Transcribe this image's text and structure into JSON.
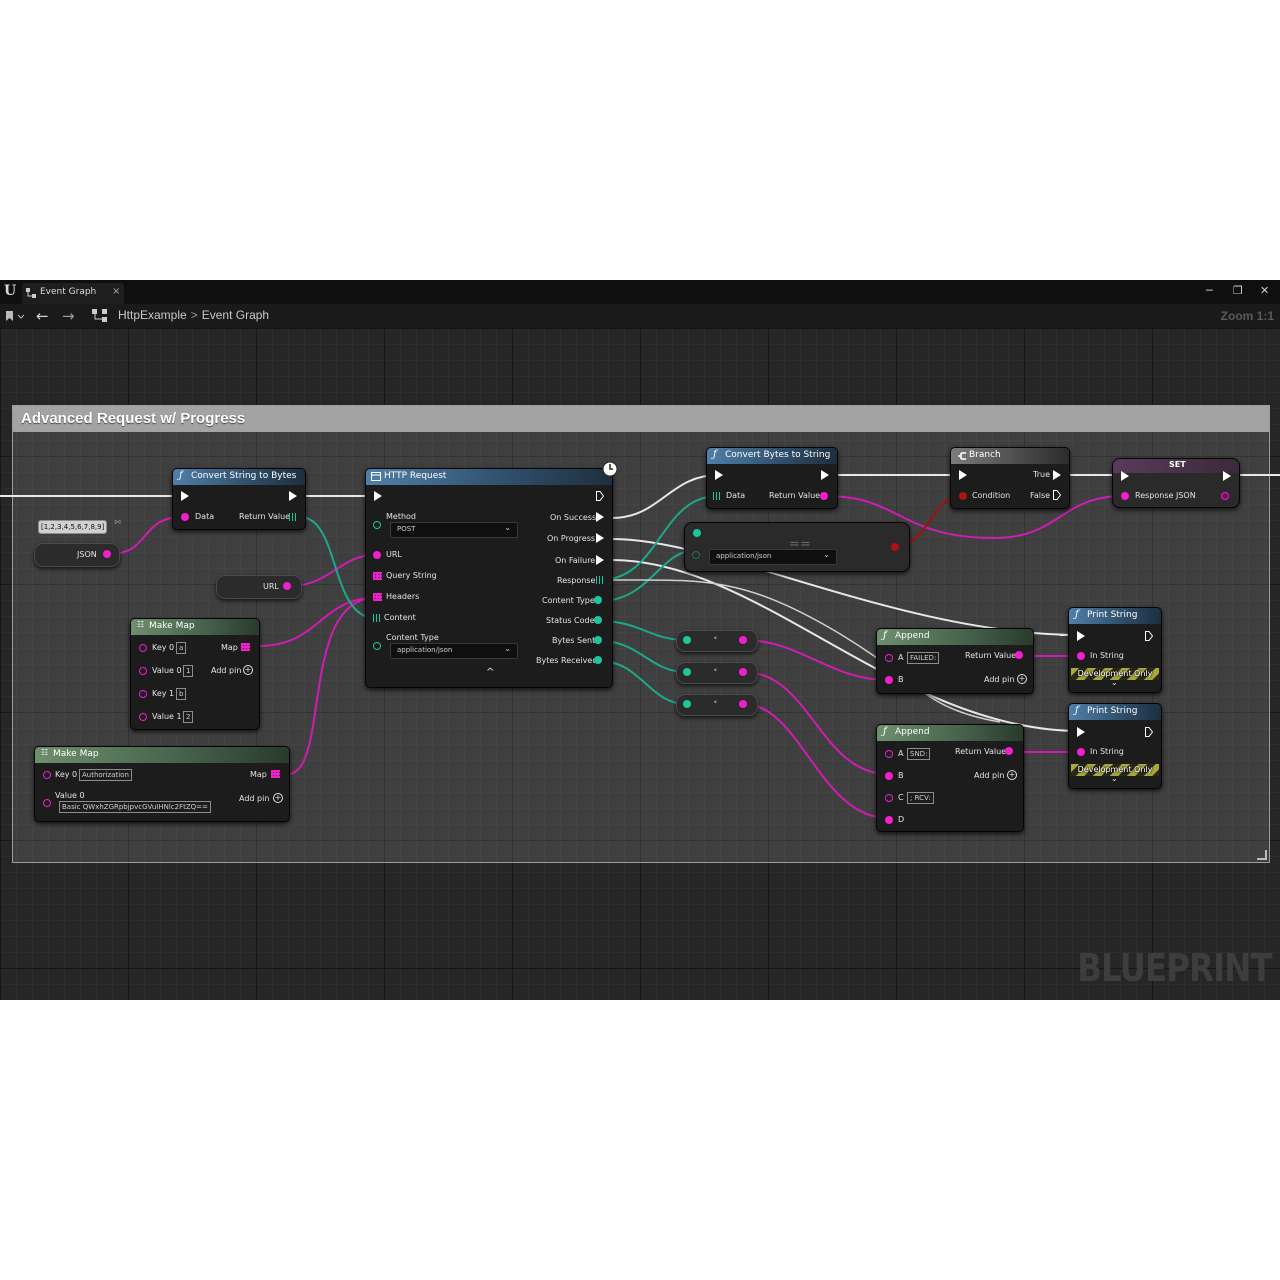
{
  "window": {
    "tab_label": "Event Graph",
    "tab_close": "×",
    "minimize": "─",
    "maximize": "❐",
    "close": "✕",
    "logo": "U"
  },
  "toolbar": {
    "breadcrumb_project": "HttpExample",
    "breadcrumb_sep": ">",
    "breadcrumb_graph": "Event Graph",
    "zoom": "Zoom 1:1",
    "back_icon": "←",
    "forward_icon": "→"
  },
  "comment": {
    "title": "Advanced Request w/ Progress"
  },
  "nodes": {
    "json_literal": "[1,2,3,4,5,6,7,8,9]",
    "json_var": "JSON",
    "url_var": "URL",
    "convert_string_to_bytes": {
      "title": "Convert String to Bytes",
      "data": "Data",
      "return": "Return Value"
    },
    "make_map_1": {
      "title": "Make Map",
      "key0": "Key 0",
      "key0_val": "a",
      "map": "Map",
      "value0": "Value 0",
      "value0_val": "1",
      "add_pin": "Add pin",
      "key1": "Key 1",
      "key1_val": "b",
      "value1": "Value 1",
      "value1_val": "2"
    },
    "make_map_2": {
      "title": "Make Map",
      "key0": "Key 0",
      "key0_val": "Authorization",
      "map": "Map",
      "value0": "Value 0",
      "value0_val": "Basic QWxhZGRpbjpvcGVuIHNlc2FtZQ==",
      "add_pin": "Add pin"
    },
    "http_request": {
      "title": "HTTP Request",
      "method_label": "Method",
      "method_value": "POST",
      "url": "URL",
      "query_string": "Query String",
      "headers": "Headers",
      "content": "Content",
      "content_type_label": "Content Type",
      "content_type_value": "application/json",
      "on_success": "On Success",
      "on_progress": "On Progress",
      "on_failure": "On Failure",
      "response": "Response",
      "content_type_out": "Content Type",
      "status_code": "Status Code",
      "bytes_sent": "Bytes Sent",
      "bytes_received": "Bytes Received",
      "collapse_icon": "^"
    },
    "convert_bytes_to_string": {
      "title": "Convert Bytes to String",
      "data": "Data",
      "return": "Return Value"
    },
    "equals": {
      "symbol": "==",
      "value": "application/json"
    },
    "branch": {
      "title": "Branch",
      "true": "True",
      "condition": "Condition",
      "false": "False"
    },
    "set": {
      "title": "SET",
      "response_json": "Response JSON"
    },
    "append_1": {
      "title": "Append",
      "a": "A",
      "a_val": "FAILED:",
      "return": "Return Value",
      "b": "B",
      "add_pin": "Add pin"
    },
    "append_2": {
      "title": "Append",
      "a": "A",
      "a_val": "SND:",
      "return": "Return Value",
      "b": "B",
      "add_pin": "Add pin",
      "c": "C",
      "c_val": "; RCV:",
      "d": "D"
    },
    "print_string_1": {
      "title": "Print String",
      "in_string": "In String",
      "dev_only": "Development Only",
      "expand_icon": "⌄"
    },
    "print_string_2": {
      "title": "Print String",
      "in_string": "In String",
      "dev_only": "Development Only",
      "expand_icon": "⌄"
    },
    "convert_nodes": [
      "•",
      "•",
      "•"
    ]
  },
  "watermark": "BLUEPRINT",
  "colors": {
    "exec": "#ffffff",
    "string_pin": "#f21ed0",
    "byte_pin": "#1cc7a0",
    "bool_pin": "#b01010",
    "function_header": "#4f7fa8",
    "make_header": "#6e8f6e"
  }
}
